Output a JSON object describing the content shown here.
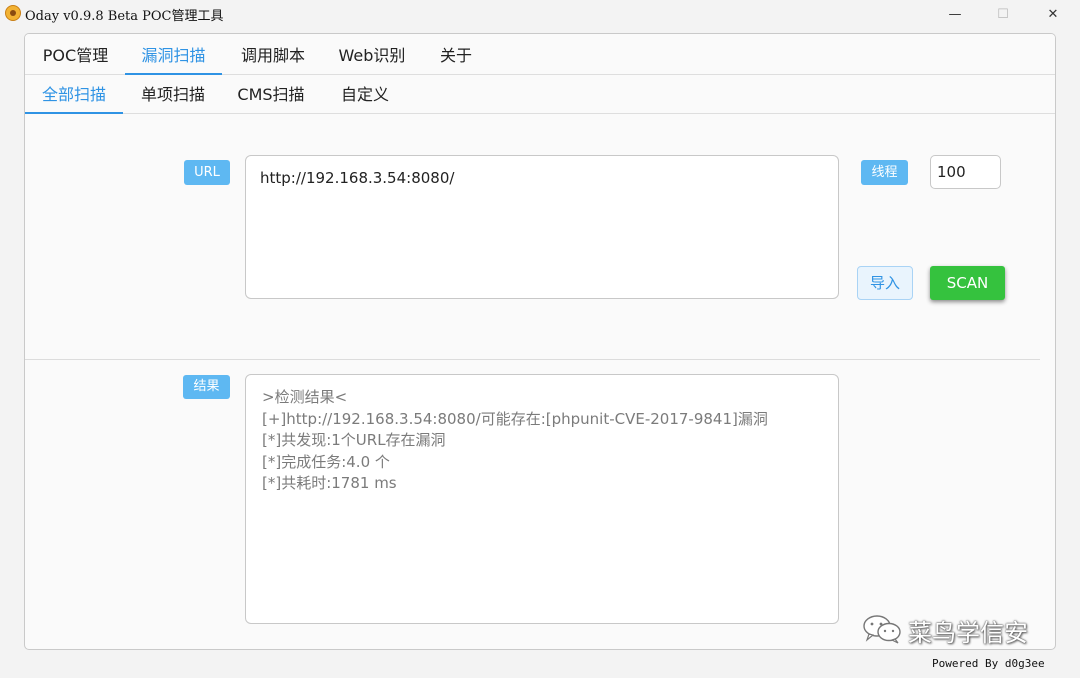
{
  "window": {
    "title": "Oday v0.9.8 Beta POC管理工具",
    "minimize_glyph": "—",
    "maximize_glyph": "☐",
    "close_glyph": "✕"
  },
  "top_tabs": [
    {
      "label": "POC管理",
      "active": false
    },
    {
      "label": "漏洞扫描",
      "active": true
    },
    {
      "label": "调用脚本",
      "active": false
    },
    {
      "label": "Web识别",
      "active": false
    },
    {
      "label": "关于",
      "active": false
    }
  ],
  "sub_tabs": [
    {
      "label": "全部扫描",
      "active": true
    },
    {
      "label": "单项扫描",
      "active": false
    },
    {
      "label": "CMS扫描",
      "active": false
    },
    {
      "label": "自定义",
      "active": false
    }
  ],
  "scan": {
    "url_label": "URL",
    "url_value": "http://192.168.3.54:8080/",
    "thread_label": "线程",
    "thread_value": "100",
    "import_label": "导入",
    "scan_label": "SCAN"
  },
  "result": {
    "label": "结果",
    "lines": [
      ">检测结果<",
      "[+]http://192.168.3.54:8080/可能存在:[phpunit-CVE-2017-9841]漏洞",
      "[*]共发现:1个URL存在漏洞",
      "[*]完成任务:4.0 个",
      "[*]共耗时:1781 ms"
    ]
  },
  "watermark": "菜鸟学信安",
  "footer": "Powered By d0g3ee",
  "colors": {
    "accent": "#2f93e4",
    "badge": "#5eb8f2",
    "scan_button": "#35c23e"
  },
  "icons": {
    "app": "app-logo-icon",
    "wechat": "wechat-icon"
  }
}
